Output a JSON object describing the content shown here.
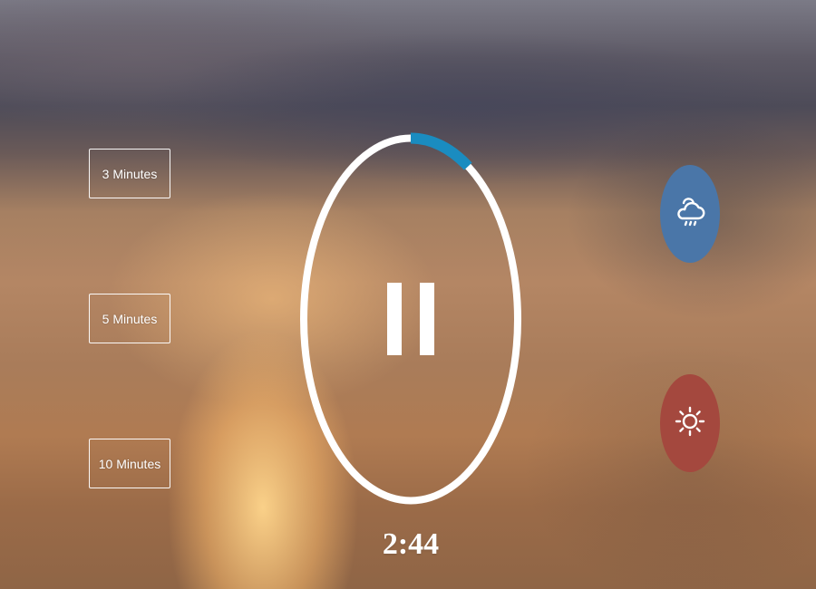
{
  "durations": [
    {
      "label": "3 Minutes"
    },
    {
      "label": "5 Minutes"
    },
    {
      "label": "10 Minutes"
    }
  ],
  "timer": {
    "display": "2:44",
    "progress": 0.09,
    "progress_color": "#1a8cc0",
    "ring_color": "#ffffff"
  },
  "player": {
    "state_icon": "pause-icon"
  },
  "sounds": [
    {
      "name": "rain",
      "icon": "rain-cloud-icon",
      "color": "#4a76a8"
    },
    {
      "name": "summer",
      "icon": "sun-icon",
      "color": "#a4483e"
    }
  ]
}
